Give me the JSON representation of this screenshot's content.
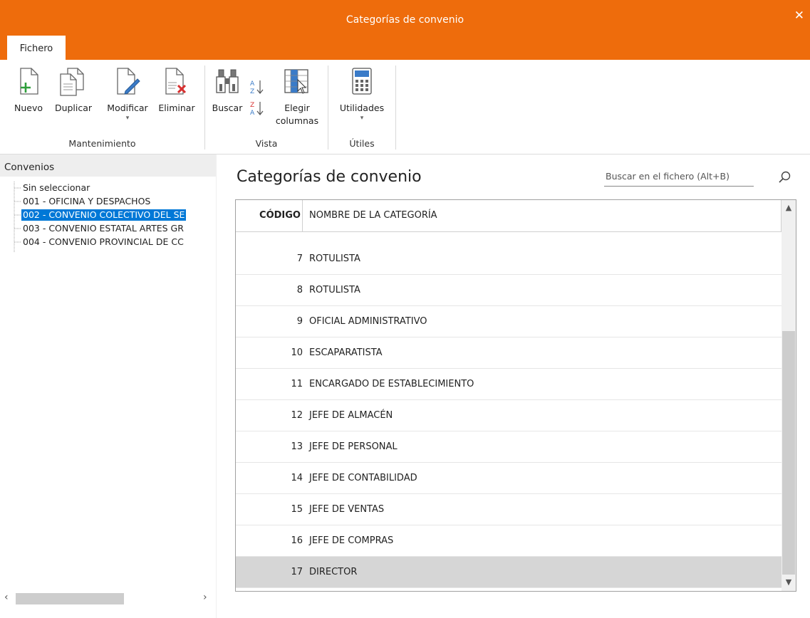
{
  "window": {
    "title": "Categorías de convenio",
    "close_glyph": "✕"
  },
  "ribbon": {
    "tab_label": "Fichero",
    "buttons": {
      "nuevo": "Nuevo",
      "duplicar": "Duplicar",
      "modificar": "Modificar",
      "eliminar": "Eliminar",
      "buscar": "Buscar",
      "elegir_line1": "Elegir",
      "elegir_line2": "columnas",
      "utilidades": "Utilidades"
    },
    "groups": {
      "mantenimiento": "Mantenimiento",
      "vista": "Vista",
      "utiles": "Útiles"
    },
    "icons": [
      "new-doc-icon",
      "duplicate-doc-icon",
      "edit-doc-icon",
      "delete-doc-icon",
      "binoculars-icon",
      "sort-az-icon",
      "sort-za-icon",
      "choose-columns-icon",
      "calculator-icon"
    ]
  },
  "sidebar": {
    "header": "Convenios",
    "items": [
      {
        "label": "Sin seleccionar"
      },
      {
        "label": "001 - OFICINA Y DESPACHOS"
      },
      {
        "label": "002 - CONVENIO COLECTIVO DEL SE"
      },
      {
        "label": "003 - CONVENIO ESTATAL ARTES GR"
      },
      {
        "label": "004 - CONVENIO PROVINCIAL DE CC"
      }
    ],
    "selected_index": 2
  },
  "main": {
    "title": "Categorías de convenio",
    "search_placeholder": "Buscar en el fichero (Alt+B)",
    "columns": {
      "code": "CÓDIGO",
      "name": "NOMBRE DE LA CATEGORÍA"
    },
    "rows": [
      {
        "code": "7",
        "name": "ROTULISTA"
      },
      {
        "code": "8",
        "name": "ROTULISTA"
      },
      {
        "code": "9",
        "name": "OFICIAL ADMINISTRATIVO"
      },
      {
        "code": "10",
        "name": "ESCAPARATISTA"
      },
      {
        "code": "11",
        "name": "ENCARGADO DE ESTABLECIMIENTO"
      },
      {
        "code": "12",
        "name": "JEFE DE ALMACÉN"
      },
      {
        "code": "13",
        "name": "JEFE DE PERSONAL"
      },
      {
        "code": "14",
        "name": "JEFE DE CONTABILIDAD"
      },
      {
        "code": "15",
        "name": "JEFE DE VENTAS"
      },
      {
        "code": "16",
        "name": "JEFE DE COMPRAS"
      },
      {
        "code": "17",
        "name": "DIRECTOR"
      }
    ],
    "selected_row": 10
  },
  "colors": {
    "accent": "#EE6C0C",
    "selection": "#0078D7",
    "row_selected": "#D6D6D6"
  }
}
